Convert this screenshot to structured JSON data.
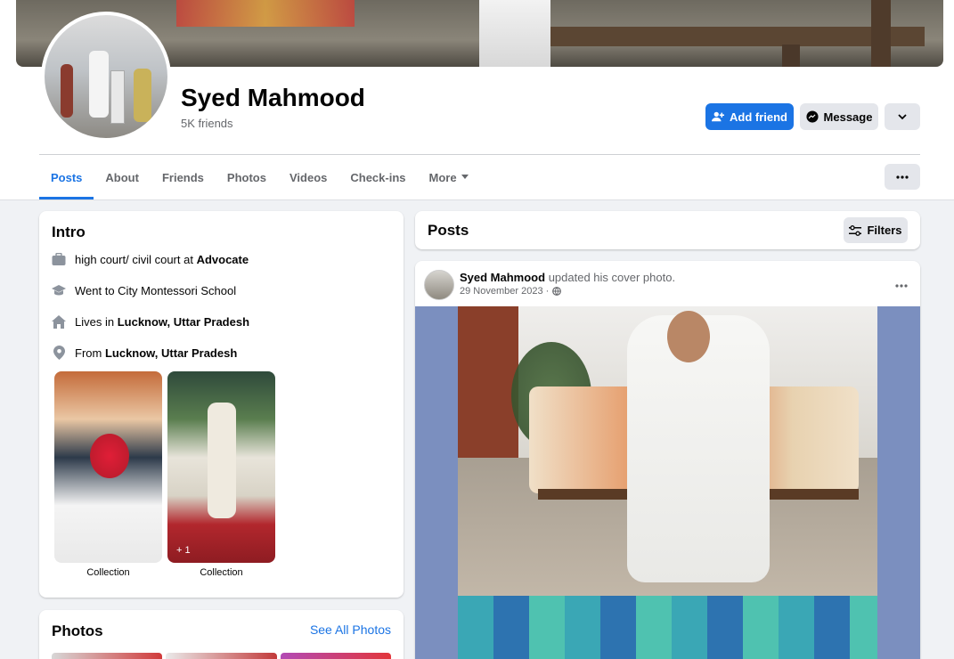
{
  "profile": {
    "name": "Syed Mahmood",
    "friends": "5K friends"
  },
  "actions": {
    "add_friend": "Add friend",
    "message": "Message"
  },
  "tabs": [
    "Posts",
    "About",
    "Friends",
    "Photos",
    "Videos",
    "Check-ins",
    "More"
  ],
  "intro": {
    "title": "Intro",
    "work_prefix": "high court/ civil court at ",
    "work_place": "Advocate",
    "education": "Went to City Montessori School",
    "lives_prefix": "Lives in ",
    "lives_place": "Lucknow, Uttar Pradesh",
    "from_prefix": "From ",
    "from_place": "Lucknow, Uttar Pradesh",
    "collections": [
      {
        "label": "Collection"
      },
      {
        "label": "Collection",
        "extra": "+ 1"
      }
    ]
  },
  "photos_section": {
    "title": "Photos",
    "see_all": "See All Photos"
  },
  "posts_section": {
    "title": "Posts",
    "filters": "Filters"
  },
  "post": {
    "author": "Syed Mahmood",
    "action": " updated his cover photo.",
    "date": "29 November 2023 ·"
  },
  "colors": {
    "accent": "#1b74e4",
    "secondary_bg": "#e4e6eb",
    "page_bg": "#f0f2f5",
    "muted_text": "#65676b"
  },
  "icons": {
    "work": "briefcase-icon",
    "education": "graduation-cap-icon",
    "lives": "home-icon",
    "from": "location-pin-icon",
    "privacy": "globe-icon",
    "filters": "sliders-icon",
    "add_friend": "add-person-icon",
    "message": "messenger-icon",
    "more": "chevron-down-icon"
  }
}
